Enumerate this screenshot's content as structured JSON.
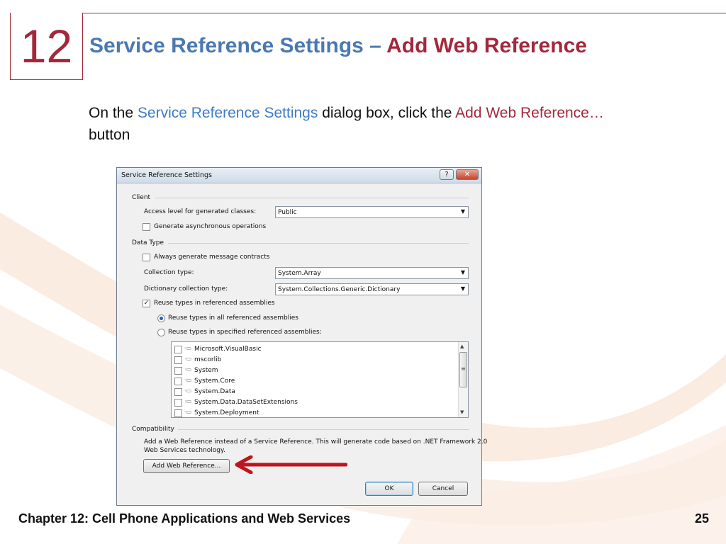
{
  "slide": {
    "chapter_number": "12",
    "title_part1": "Service Reference Settings – ",
    "title_part2": "Add Web Reference",
    "body_prefix": "On the ",
    "body_highlight1": "Service Reference Settings",
    "body_middle": " dialog box, click the ",
    "body_highlight2": "Add Web Reference…",
    "body_suffix": " button",
    "footer_left": "Chapter 12: Cell Phone Applications and Web Services",
    "page_number": "25"
  },
  "dialog": {
    "title": "Service Reference Settings",
    "help_glyph": "?",
    "close_glyph": "✕",
    "client_group": "Client",
    "access_level_label": "Access level for generated classes:",
    "access_level_value": "Public",
    "async_label": "Generate asynchronous operations",
    "data_type_group": "Data Type",
    "message_contracts_label": "Always generate message contracts",
    "collection_type_label": "Collection type:",
    "collection_type_value": "System.Array",
    "dictionary_type_label": "Dictionary collection type:",
    "dictionary_type_value": "System.Collections.Generic.Dictionary",
    "reuse_types_label": "Reuse types in referenced assemblies",
    "reuse_all_label": "Reuse types in all referenced assemblies",
    "reuse_specified_label": "Reuse types in specified referenced assemblies:",
    "assemblies": [
      "Microsoft.VisualBasic",
      "mscorlib",
      "System",
      "System.Core",
      "System.Data",
      "System.Data.DataSetExtensions",
      "System.Deployment"
    ],
    "compatibility_group": "Compatibility",
    "compat_line1": "Add a Web Reference instead of a Service Reference. This will generate code based on .NET Framework 2.0",
    "compat_line2": "Web Services technology.",
    "add_web_reference_button": "Add Web Reference...",
    "ok_button": "OK",
    "cancel_button": "Cancel"
  },
  "colors": {
    "accent_red": "#a3283b",
    "accent_blue": "#4a78b3",
    "arrow_red": "#c0141c"
  }
}
